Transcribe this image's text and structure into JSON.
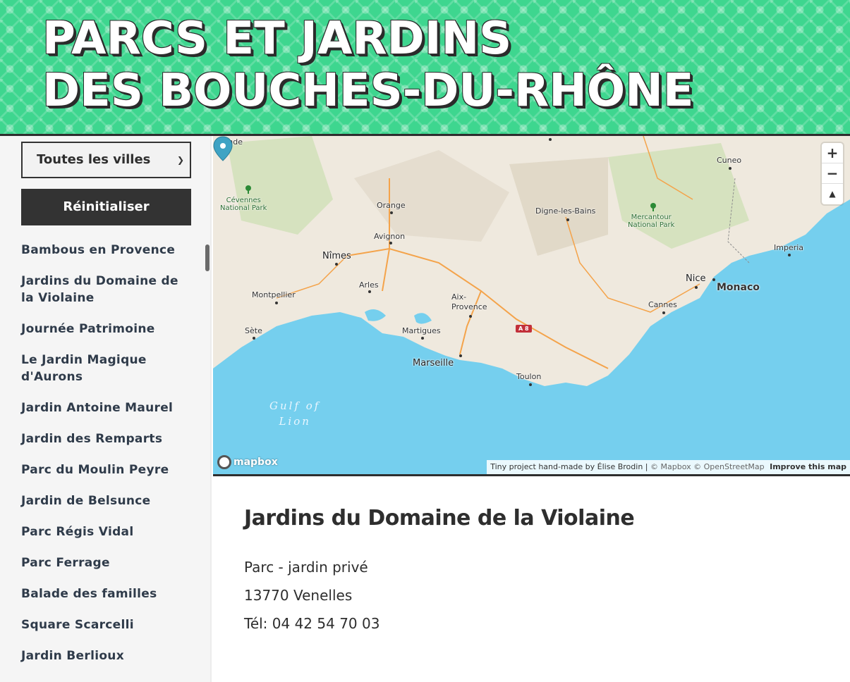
{
  "header": {
    "title_line1": "PARCS ET JARDINS",
    "title_line2": "DES BOUCHES-DU-RHÔNE"
  },
  "sidebar": {
    "city_filter": {
      "selected": "Toutes les villes"
    },
    "reset_label": "Réinitialiser",
    "parks": [
      "Bambous en Provence",
      "Jardins du Domaine de la Violaine",
      "Journée Patrimoine",
      "Le Jardin Magique d'Aurons",
      "Jardin Antoine Maurel",
      "Jardin des Remparts",
      "Parc du Moulin Peyre",
      "Jardin de Belsunce",
      "Parc Régis Vidal",
      "Parc Ferrage",
      "Balade des familles",
      "Square Scarcelli",
      "Jardin Berlioux"
    ]
  },
  "map": {
    "places": {
      "mende": "Mende",
      "cuneo": "Cuneo",
      "cevennes": "Cévennes\nNational Park",
      "orange": "Orange",
      "digne": "Digne-les-Bains",
      "mercantour": "Mercantour\nNational Park",
      "avignon": "Avignon",
      "nimes": "Nîmes",
      "imperia": "Imperia",
      "arles": "Arles",
      "montpellier": "Montpellier",
      "aix": "Aix-\nProvence",
      "nice": "Nice",
      "monaco": "Monaco",
      "cannes": "Cannes",
      "sete": "Sète",
      "martigues": "Martigues",
      "marseille": "Marseille",
      "toulon": "Toulon",
      "gulf": "Gulf of\nLion",
      "road": "A 8"
    },
    "controls": {
      "zoom_in": "+",
      "zoom_out": "−",
      "compass": "▲"
    },
    "logo": "mapbox",
    "attribution": {
      "credit": "Tiny project hand-made by Élise Brodin |",
      "mapbox": "© Mapbox",
      "osm": "© OpenStreetMap",
      "improve": "Improve this map"
    },
    "colors": {
      "sea": "#75cfee",
      "land": "#efe9de",
      "forest": "#cfe0b6",
      "road": "#f4a34a",
      "marker": "#3fa3c4"
    }
  },
  "detail": {
    "name": "Jardins du Domaine de la Violaine",
    "type": "Parc - jardin privé",
    "address": "13770 Venelles",
    "phone": "Tél: 04 42 54 70 03"
  }
}
